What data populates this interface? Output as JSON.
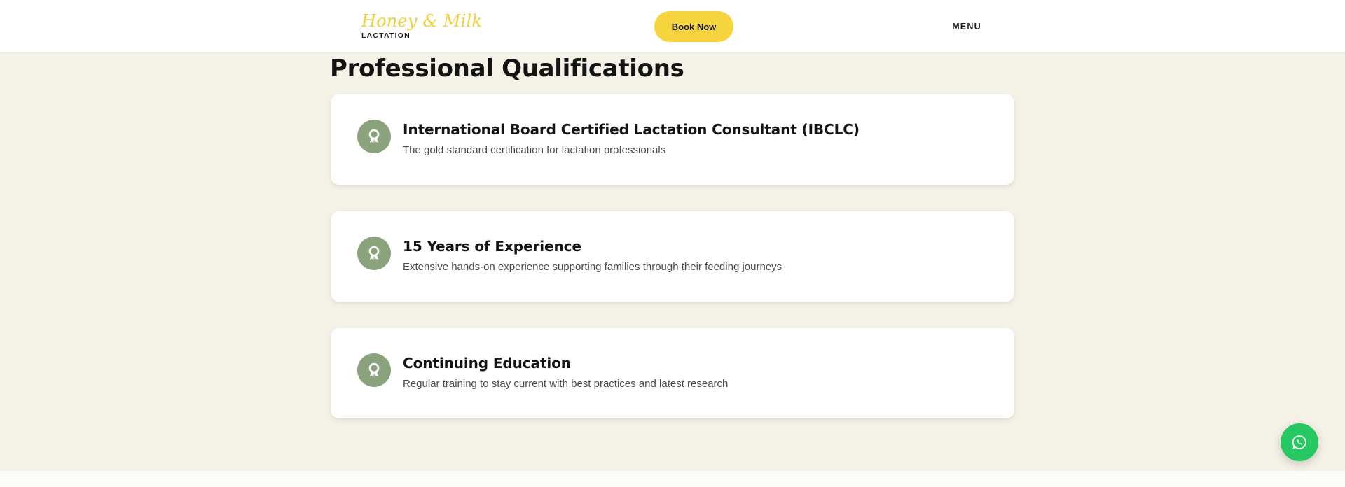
{
  "header": {
    "logo_script": "Honey & Milk",
    "logo_sub": "LACTATION",
    "book_label": "Book Now",
    "menu_label": "MENU"
  },
  "section": {
    "title": "Professional Qualifications",
    "cards": [
      {
        "icon": "award-ribbon-icon",
        "title": "International Board Certified Lactation Consultant (IBCLC)",
        "desc": "The gold standard certification for lactation professionals"
      },
      {
        "icon": "award-ribbon-icon",
        "title": "15 Years of Experience",
        "desc": "Extensive hands-on experience supporting families through their feeding journeys"
      },
      {
        "icon": "award-ribbon-icon",
        "title": "Continuing Education",
        "desc": "Regular training to stay current with best practices and latest research"
      }
    ]
  },
  "floating": {
    "chat_icon": "whatsapp-icon"
  },
  "colors": {
    "accent_yellow": "#f5d43e",
    "logo_yellow": "#f2cd3c",
    "section_bg": "#f4f2e7",
    "icon_green": "#8aa37d",
    "whatsapp_green": "#25c861"
  }
}
